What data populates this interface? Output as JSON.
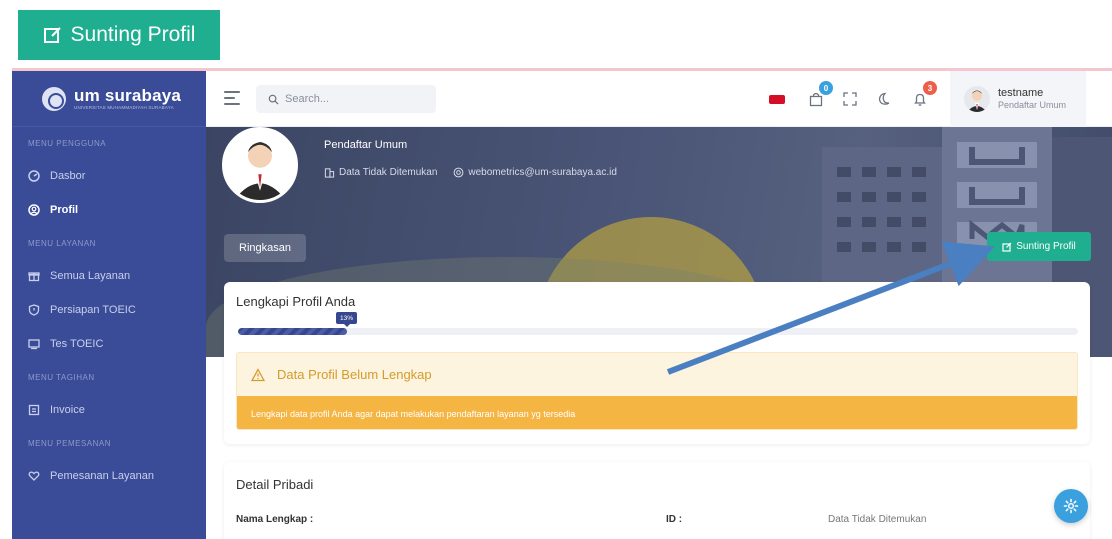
{
  "banner": {
    "label": "Sunting Profil"
  },
  "brand": {
    "name": "um surabaya",
    "subtitle": "UNIVERSITAS MUHAMMADIYAH SURABAYA"
  },
  "sidebar": {
    "sections": [
      {
        "heading": "MENU PENGGUNA",
        "items": [
          {
            "label": "Dasbor",
            "icon": "dashboard-icon"
          },
          {
            "label": "Profil",
            "icon": "user-circle-icon",
            "active": true
          }
        ]
      },
      {
        "heading": "MENU LAYANAN",
        "items": [
          {
            "label": "Semua Layanan",
            "icon": "gift-icon"
          },
          {
            "label": "Persiapan TOEIC",
            "icon": "shield-icon"
          },
          {
            "label": "Tes TOEIC",
            "icon": "monitor-icon"
          }
        ]
      },
      {
        "heading": "MENU TAGIHAN",
        "items": [
          {
            "label": "Invoice",
            "icon": "invoice-icon"
          }
        ]
      },
      {
        "heading": "MENU PEMESANAN",
        "items": [
          {
            "label": "Pemesanan Layanan",
            "icon": "heart-hands-icon"
          }
        ]
      }
    ]
  },
  "header": {
    "search_placeholder": "Search...",
    "cart_count": "0",
    "notification_count": "3",
    "user_name": "testname",
    "user_role": "Pendaftar Umum"
  },
  "hero": {
    "role": "Pendaftar Umum",
    "id_text": "Data Tidak Ditemukan",
    "email": "webometrics@um-surabaya.ac.id",
    "tab_label": "Ringkasan",
    "edit_button": "Sunting Profil"
  },
  "progress_card": {
    "title": "Lengkapi Profil Anda",
    "percent_label": "13%",
    "percent_value": 13,
    "alert_title": "Data Profil Belum Lengkap",
    "alert_message": "Lengkapi data profil Anda agar dapat melakukan pendaftaran layanan yg tersedia"
  },
  "detail_card": {
    "title": "Detail Pribadi",
    "full_name_label": "Nama Lengkap :",
    "id_label": "ID :",
    "id_value": "Data Tidak Ditemukan"
  },
  "colors": {
    "sidebar": "#3a4b97",
    "accent_green": "#1faf90",
    "warning": "#f5b542",
    "fab": "#3aa0de",
    "annotation_arrow": "#4a7fc1"
  }
}
